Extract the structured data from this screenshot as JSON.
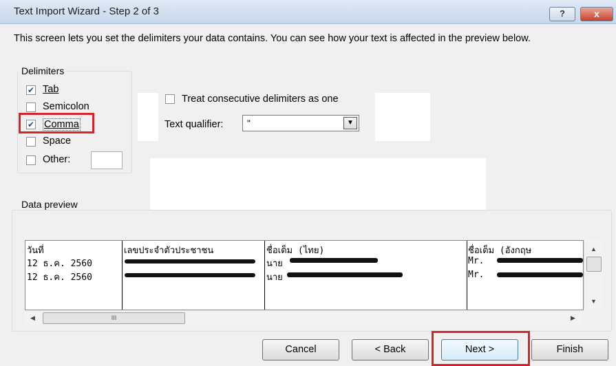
{
  "window": {
    "title": "Text Import Wizard - Step 2 of 3",
    "help_label": "?",
    "close_label": "x"
  },
  "description": "This screen lets you set the delimiters your data contains.  You can see how your text is affected in the preview below.",
  "delimiters": {
    "label": "Delimiters",
    "tab": {
      "label": "Tab",
      "checked": true
    },
    "semicolon": {
      "label": "Semicolon",
      "checked": false
    },
    "comma": {
      "label": "Comma",
      "checked": true
    },
    "space": {
      "label": "Space",
      "checked": false
    },
    "other": {
      "label": "Other:",
      "checked": false,
      "value": ""
    }
  },
  "options": {
    "consecutive_label": "Treat consecutive delimiters as one",
    "consecutive_checked": false,
    "qualifier_label": "Text qualifier:",
    "qualifier_value": "\""
  },
  "preview": {
    "label": "Data preview",
    "headers": [
      "วันที่",
      "เลขประจำตัวประชาชน",
      "ชื่อเต็ม (ไทย)",
      "ชื่อเต็ม (อังกฤษ"
    ],
    "rows": [
      [
        "12 ธ.ค. 2560",
        "",
        "นาย",
        "Mr."
      ],
      [
        "12 ธ.ค. 2560",
        "",
        "นาย",
        "Mr."
      ]
    ],
    "hscroll_thumb": "III"
  },
  "buttons": {
    "cancel": "Cancel",
    "back": "< Back",
    "next": "Next >",
    "finish": "Finish"
  },
  "icons": [
    "check-icon",
    "dropdown-arrow-icon",
    "scroll-up-icon",
    "scroll-down-icon",
    "scroll-left-icon",
    "scroll-right-icon"
  ]
}
